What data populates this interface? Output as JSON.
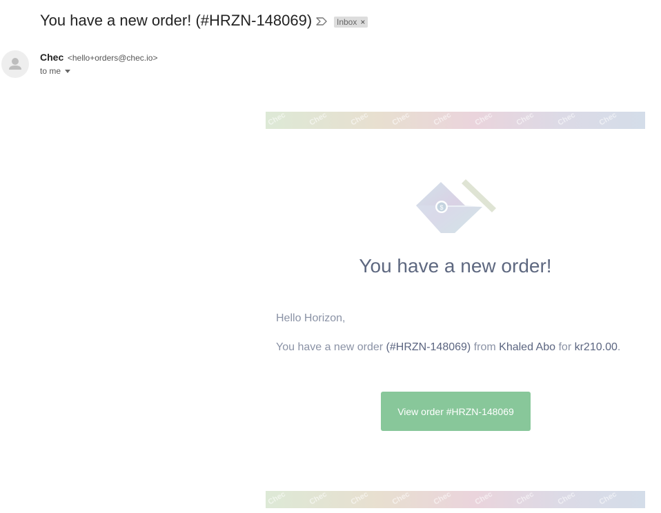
{
  "header": {
    "subject": "You have a new order! (#HRZN-148069)",
    "label_chip": "Inbox",
    "label_close": "×",
    "importance_icon": "importance-marker-icon"
  },
  "sender": {
    "name": "Chec",
    "email": "<hello+orders@chec.io>",
    "recipient": "to me",
    "avatar_icon": "person-icon"
  },
  "email": {
    "banner_watermark": "Chec",
    "logo_icon": "chec-logo-icon",
    "headline": "You have a new order!",
    "greeting": "Hello Horizon,",
    "order_prefix": "You have a new order",
    "order_id": "(#HRZN-148069)",
    "order_from": "from",
    "customer": "Khaled Abo",
    "order_for": "for",
    "amount": "kr210.00",
    "period": ".",
    "button_label": "View order #HRZN-148069"
  },
  "colors": {
    "headline": "#5e6880",
    "body_text": "#8a92a5",
    "highlight_text": "#5b6580",
    "button_bg": "#88c79a",
    "chip_bg": "#dddddd"
  }
}
